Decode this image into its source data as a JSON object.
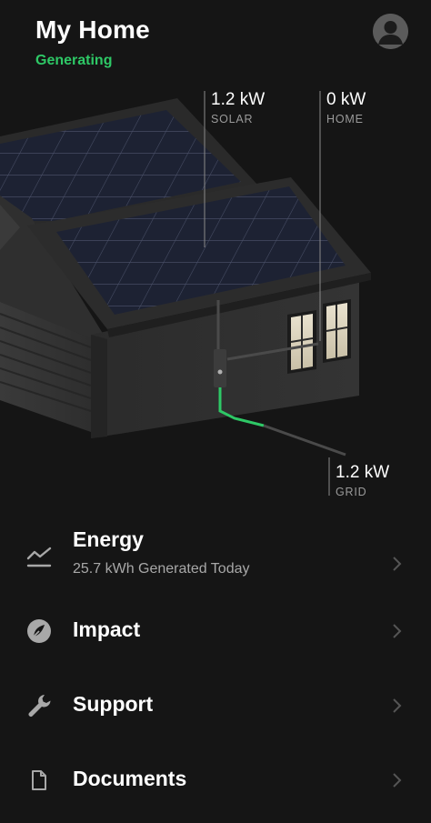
{
  "header": {
    "title": "My Home",
    "status": "Generating",
    "status_color": "#2ec866"
  },
  "readouts": {
    "solar": {
      "value": "1.2 kW",
      "label": "SOLAR"
    },
    "home": {
      "value": "0 kW",
      "label": "HOME"
    },
    "grid": {
      "value": "1.2 kW",
      "label": "GRID"
    }
  },
  "menu": {
    "items": [
      {
        "label": "Energy",
        "subtitle": "25.7 kWh Generated Today",
        "icon": "energy-chart-icon"
      },
      {
        "label": "Impact",
        "icon": "leaf-icon"
      },
      {
        "label": "Support",
        "icon": "wrench-icon"
      },
      {
        "label": "Documents",
        "icon": "document-icon"
      }
    ]
  },
  "colors": {
    "background": "#151515",
    "accent_green": "#2ec866",
    "text_secondary": "#a8a8a8"
  }
}
